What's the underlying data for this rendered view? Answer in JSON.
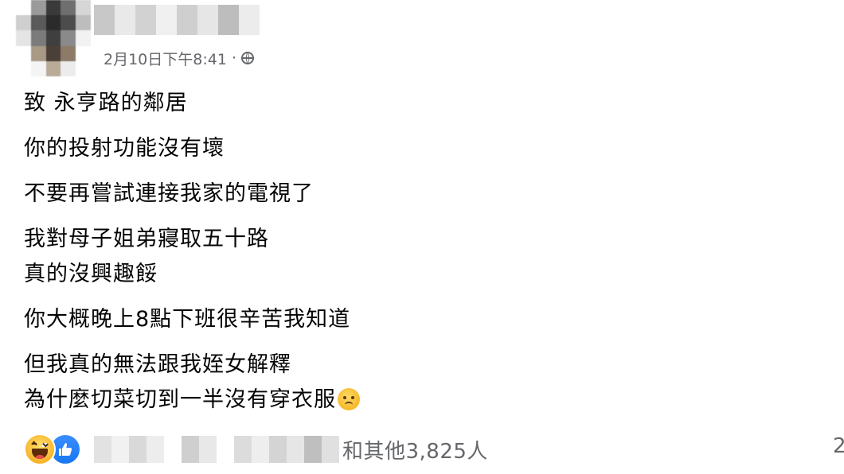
{
  "post": {
    "timestamp": "2月10日下午8:41",
    "separator": "·",
    "privacy_icon": "globe-icon",
    "paragraphs": [
      [
        "致 永亨路的鄰居"
      ],
      [
        "你的投射功能沒有壞"
      ],
      [
        "不要再嘗試連接我家的電視了"
      ],
      [
        "我對母子姐弟寢取五十路",
        "真的沒興趣餒"
      ],
      [
        "你大概晚上8點下班很辛苦我知道"
      ],
      [
        "但我真的無法跟我姪女解釋",
        "為什麼切菜切到一半沒有穿衣服"
      ]
    ],
    "trailing_emoji": "sad-face-emoji"
  },
  "reactions": {
    "icons": [
      "haha-icon",
      "like-icon"
    ],
    "others_text": "和其他3,825人",
    "right_count": "2"
  },
  "colors": {
    "text": "#050505",
    "secondary": "#65676b",
    "like_blue": "#1877f2",
    "haha_yellow": "#f7b125"
  }
}
